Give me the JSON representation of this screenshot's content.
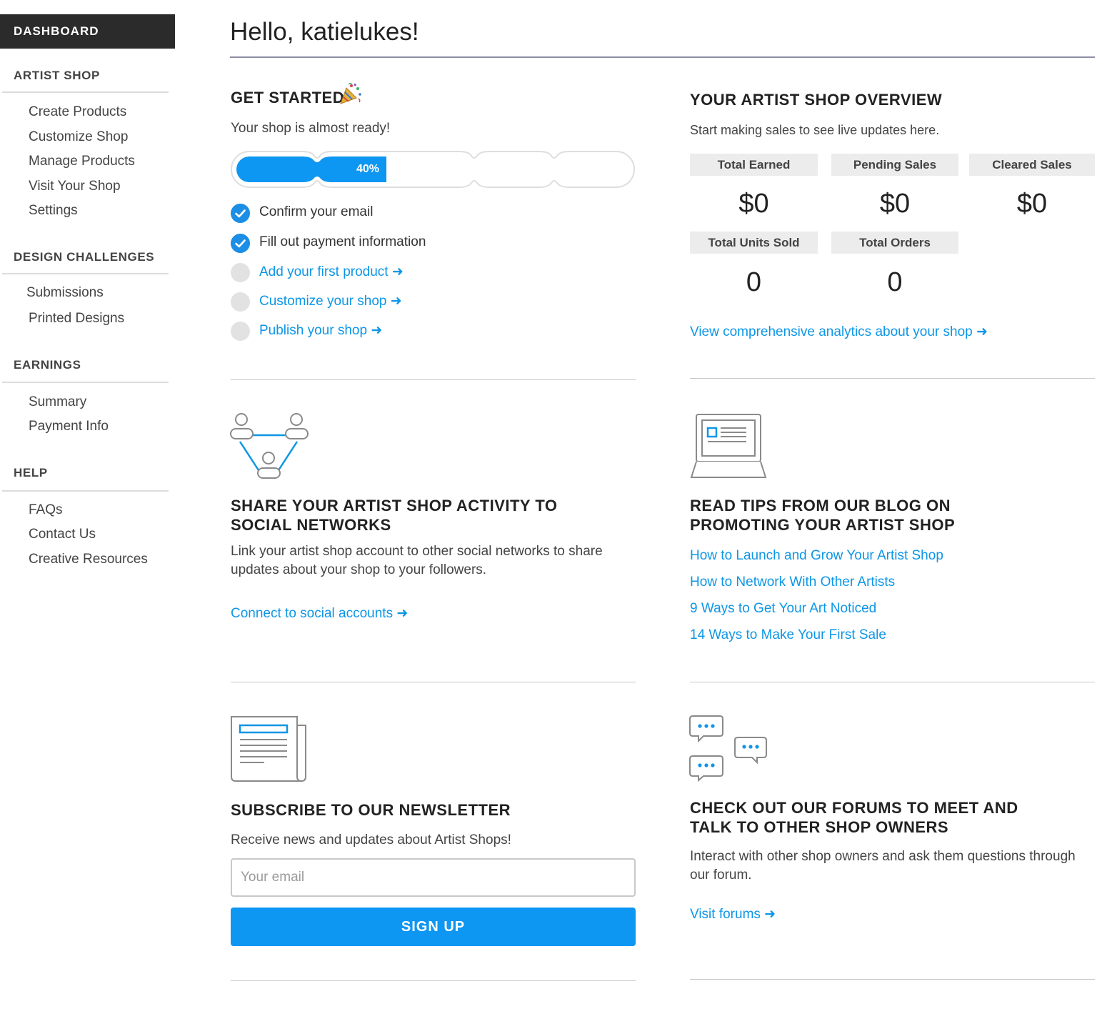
{
  "sidebar": {
    "dashboard_label": "DASHBOARD",
    "sections": [
      {
        "heading": "ARTIST SHOP",
        "items": [
          "Create Products",
          "Customize Shop",
          "Manage Products",
          "Visit Your Shop",
          "Settings"
        ]
      },
      {
        "heading": "DESIGN CHALLENGES",
        "items": [
          "Submissions",
          "Printed Designs"
        ]
      },
      {
        "heading": "EARNINGS",
        "items": [
          "Summary",
          "Payment Info"
        ]
      },
      {
        "heading": "HELP",
        "items": [
          "FAQs",
          "Contact Us",
          "Creative Resources"
        ]
      }
    ]
  },
  "header": {
    "greeting": "Hello, katielukes!"
  },
  "get_started": {
    "title": "GET STARTED",
    "icon": "party-popper-icon",
    "subtitle": "Your shop is almost ready!",
    "progress_label": "40%",
    "progress_value": 0.4,
    "steps": [
      {
        "label": "Confirm your email",
        "done": true
      },
      {
        "label": "Fill out payment information",
        "done": true
      },
      {
        "label": "Add your first product ➜",
        "done": false
      },
      {
        "label": "Customize your shop ➜",
        "done": false
      },
      {
        "label": "Publish your shop ➜",
        "done": false
      }
    ]
  },
  "overview": {
    "title": "YOUR ARTIST SHOP OVERVIEW",
    "subtitle": "Start making sales to see live updates here.",
    "stats": {
      "total_earned": {
        "label": "Total Earned",
        "value": "$0"
      },
      "pending_sales": {
        "label": "Pending Sales",
        "value": "$0"
      },
      "cleared_sales": {
        "label": "Cleared Sales",
        "value": "$0"
      },
      "total_units_sold": {
        "label": "Total Units Sold",
        "value": "0"
      },
      "total_orders": {
        "label": "Total Orders",
        "value": "0"
      }
    },
    "analytics_link": "View comprehensive analytics about your shop ➜"
  },
  "social": {
    "title_line1": "SHARE YOUR ARTIST SHOP ACTIVITY TO",
    "title_line2": "SOCIAL NETWORKS",
    "body": "Link your artist shop account to other social networks to share updates about your shop to your followers.",
    "link": "Connect to social accounts ➜"
  },
  "blog": {
    "title_line1": "READ TIPS FROM OUR BLOG ON",
    "title_line2": "PROMOTING YOUR ARTIST SHOP",
    "links": [
      "How to Launch and Grow Your Artist Shop",
      "How to Network With Other Artists",
      "9 Ways to Get Your Art Noticed",
      "14 Ways to Make Your First Sale"
    ]
  },
  "newsletter": {
    "title": "SUBSCRIBE TO OUR NEWSLETTER",
    "body": "Receive news and updates about Artist Shops!",
    "email_placeholder": "Your email",
    "signup_label": "SIGN UP"
  },
  "forums": {
    "title_line1": "CHECK OUT OUR FORUMS TO MEET AND",
    "title_line2": "TALK TO OTHER SHOP OWNERS",
    "body": "Interact with other shop owners and ask them questions through our forum.",
    "link": "Visit forums ➜"
  },
  "colors": {
    "accent": "#0d96f2",
    "link": "#0d96e6",
    "sidebar_dark": "#2b2b2b",
    "stat_bg": "#ececec"
  }
}
